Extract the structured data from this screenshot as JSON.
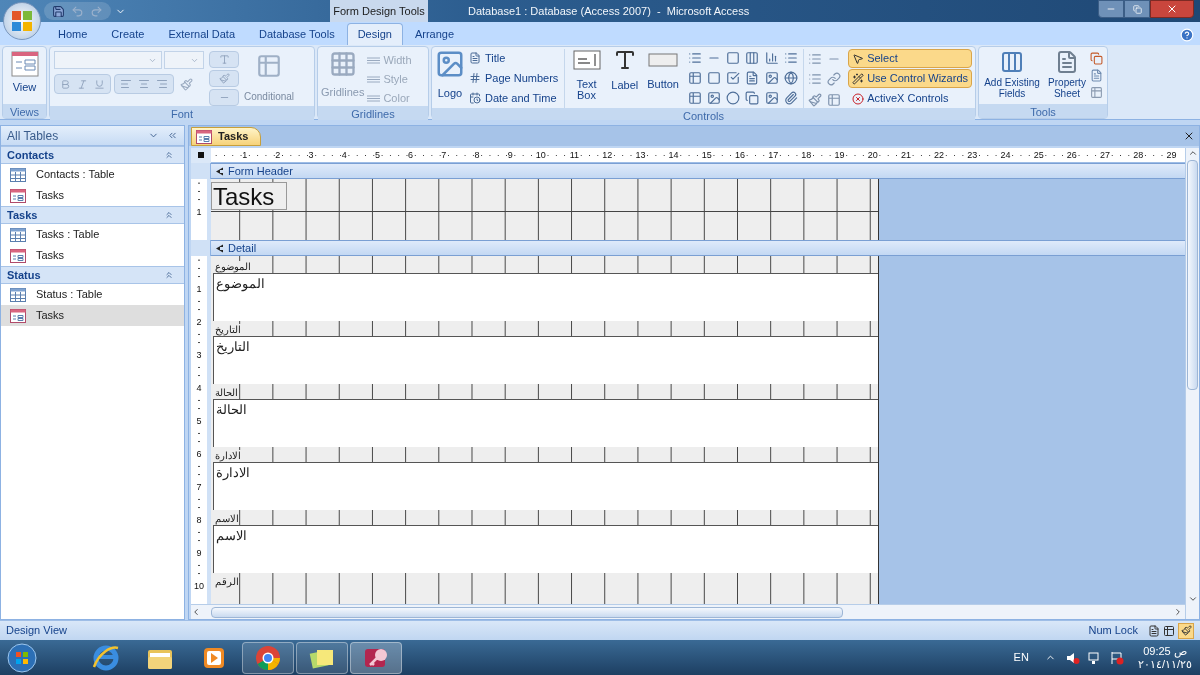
{
  "window": {
    "title": "Database1 : Database (Access 2007)  -  Microsoft Access",
    "context_label": "Form Design Tools"
  },
  "ribbon_tabs": [
    {
      "label": "Home",
      "selected": false
    },
    {
      "label": "Create",
      "selected": false
    },
    {
      "label": "External Data",
      "selected": false
    },
    {
      "label": "Database Tools",
      "selected": false
    },
    {
      "label": "Design",
      "selected": true
    },
    {
      "label": "Arrange",
      "selected": false
    }
  ],
  "ribbon": {
    "views": {
      "label": "Views",
      "button": "View"
    },
    "font": {
      "label": "Font",
      "conditional": "Conditional"
    },
    "gridlines": {
      "label": "Gridlines",
      "button": "Gridlines",
      "options": [
        "Width",
        "Style",
        "Color"
      ]
    },
    "controls": {
      "label": "Controls",
      "logo": "Logo",
      "header_items": [
        "Title",
        "Page Numbers",
        "Date and Time"
      ],
      "big": [
        "Text Box",
        "Label",
        "Button"
      ],
      "modes": [
        {
          "label": "Select",
          "on": true
        },
        {
          "label": "Use Control Wizards",
          "on": true
        },
        {
          "label": "ActiveX Controls",
          "on": false
        }
      ]
    },
    "tools": {
      "label": "Tools",
      "buttons": [
        "Add Existing Fields",
        "Property Sheet"
      ]
    }
  },
  "nav": {
    "title": "All Tables",
    "groups": [
      {
        "title": "Contacts",
        "items": [
          {
            "label": "Contacts : Table",
            "kind": "table",
            "selected": false
          },
          {
            "label": "Tasks",
            "kind": "form",
            "selected": false
          }
        ]
      },
      {
        "title": "Tasks",
        "items": [
          {
            "label": "Tasks : Table",
            "kind": "table",
            "selected": false
          },
          {
            "label": "Tasks",
            "kind": "form",
            "selected": false
          }
        ]
      },
      {
        "title": "Status",
        "items": [
          {
            "label": "Status : Table",
            "kind": "table",
            "selected": false
          },
          {
            "label": "Tasks",
            "kind": "form",
            "selected": true
          }
        ]
      }
    ]
  },
  "document": {
    "tab": "Tasks",
    "ruler": [
      "1",
      "2",
      "3",
      "4",
      "5",
      "6",
      "7",
      "8",
      "9",
      "10",
      "11",
      "12",
      "13",
      "14",
      "15",
      "16",
      "17",
      "18",
      "19",
      "20",
      "21",
      "22",
      "23",
      "24",
      "25",
      "26",
      "27",
      "28",
      "29"
    ],
    "header": {
      "band": "Form Header",
      "title": "Tasks",
      "ruler": [
        "1"
      ]
    },
    "detail": {
      "band": "Detail",
      "ruler": [
        "1",
        "2",
        "3",
        "4",
        "5",
        "6",
        "7",
        "8",
        "9",
        "10"
      ],
      "fields": [
        {
          "label": "الموضوع",
          "textbox": "الموضوع"
        },
        {
          "label": "التاريخ",
          "textbox": "التاريخ"
        },
        {
          "label": "الحالة",
          "textbox": "الحالة"
        },
        {
          "label": "الادارة",
          "textbox": "الادارة"
        },
        {
          "label": "الاسم",
          "textbox": "الاسم"
        },
        {
          "label": "الرقم"
        }
      ]
    }
  },
  "status_bar": {
    "left": "Design View",
    "right": "Num Lock"
  },
  "taskbar": {
    "apps": [
      {
        "kind": "ie",
        "running": false,
        "selected": false
      },
      {
        "kind": "folder",
        "running": false,
        "selected": false
      },
      {
        "kind": "media",
        "running": false,
        "selected": false
      },
      {
        "kind": "chrome",
        "running": true,
        "selected": false
      },
      {
        "kind": "notes",
        "running": true,
        "selected": false
      },
      {
        "kind": "access",
        "running": true,
        "selected": true
      }
    ],
    "language": "EN",
    "time": "09:25 ص",
    "date": "٢٠١٤/١١/٢٥"
  }
}
